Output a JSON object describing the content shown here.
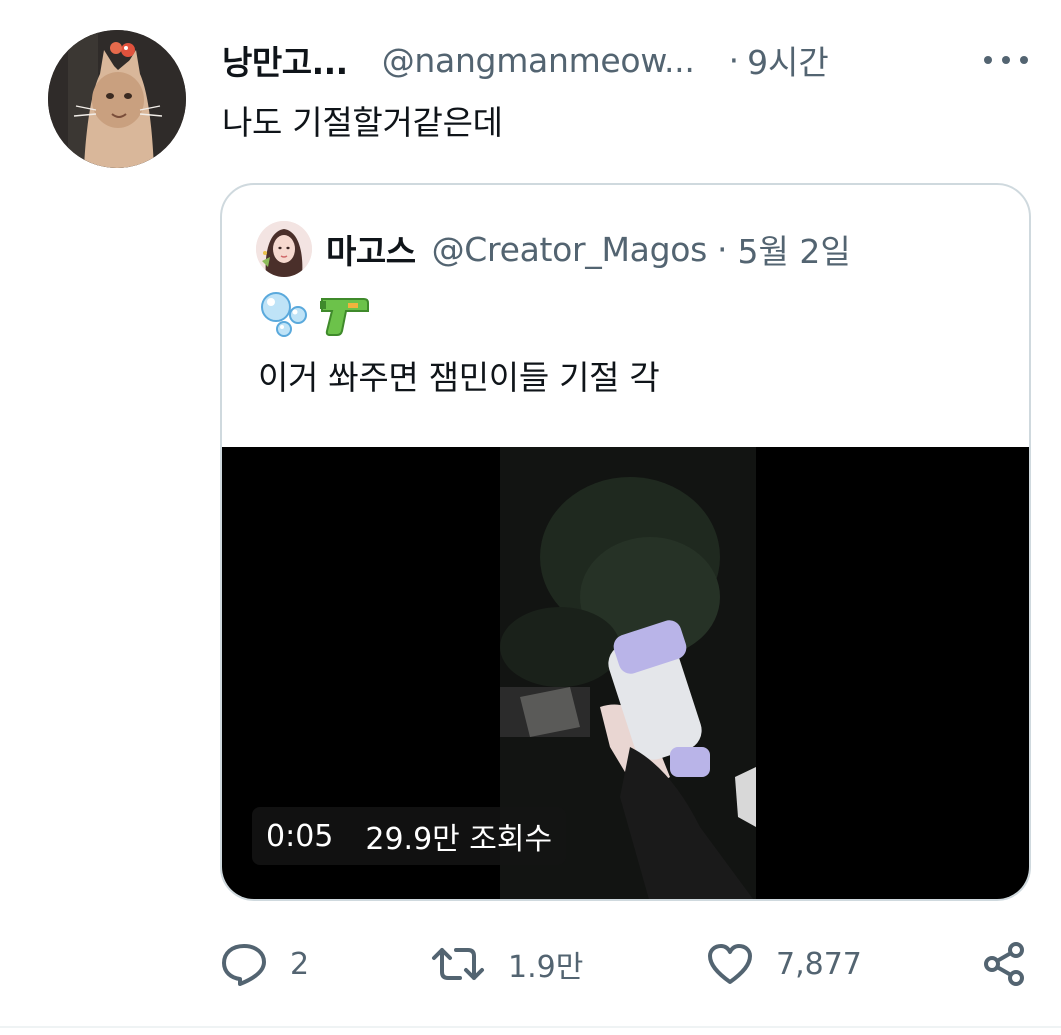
{
  "tweet": {
    "author_name": "낭만고...",
    "author_handle": "@nangmanmeow...",
    "separator": "·",
    "time": "9시간",
    "text": "나도 기절할거같은데"
  },
  "quote": {
    "author_name": "마고스",
    "author_handle": "@Creator_Magos",
    "separator": "·",
    "date": "5월 2일",
    "emojis": [
      "bubbles-emoji",
      "water-pistol-emoji"
    ],
    "text": "이거 쏴주면 잼민이들 기절 각",
    "video": {
      "duration": "0:05",
      "views": "29.9만 조회수"
    }
  },
  "actions": {
    "reply_count": "2",
    "retweet_count": "1.9만",
    "like_count": "7,877"
  },
  "icons": {
    "reply": "reply-icon",
    "retweet": "retweet-icon",
    "like": "heart-icon",
    "share": "share-icon",
    "more": "more-icon"
  },
  "colors": {
    "text_primary": "#0f1419",
    "text_secondary": "#536471",
    "border": "#cfd9de"
  }
}
